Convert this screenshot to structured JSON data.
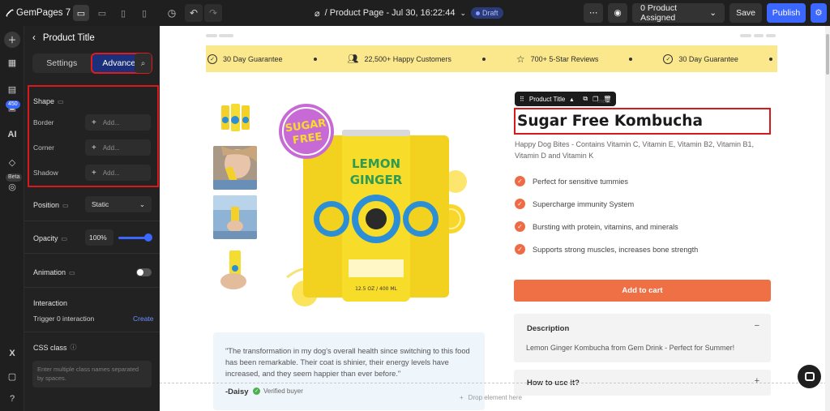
{
  "topbar": {
    "brand": "GemPages 7",
    "page_title": "/ Product Page - Jul 30, 16:22:44",
    "draft_badge": "Draft",
    "product_assigned": "0 Product Assigned",
    "save_label": "Save",
    "publish_label": "Publish"
  },
  "rail": {
    "badge_count": "450",
    "ai_label": "AI",
    "beta_label": "Beta"
  },
  "panel": {
    "title": "Product Title",
    "tabs": {
      "settings": "Settings",
      "advanced": "Advanced"
    },
    "shape_label": "Shape",
    "border_label": "Border",
    "corner_label": "Corner",
    "shadow_label": "Shadow",
    "add_placeholder": "Add...",
    "position_label": "Position",
    "position_value": "Static",
    "opacity_label": "Opacity",
    "opacity_value": "100%",
    "opacity_level": 1.0,
    "animation_label": "Animation",
    "interaction_label": "Interaction",
    "trigger_text": "Trigger 0 interaction",
    "create_label": "Create",
    "css_class_label": "CSS class",
    "css_placeholder": "Enter multiple class names separated by spaces."
  },
  "ticker": {
    "items": [
      "30 Day Guarantee",
      "22,500+ Happy Customers",
      "700+ 5-Star Reviews",
      "30 Day Guarantee"
    ]
  },
  "product": {
    "toolbar_label": "Product Title",
    "crumb_faint": "mers",
    "title": "Sugar Free Kombucha",
    "subtitle": "Happy Dog Bites - Contains Vitamin C, Vitamin E, Vitamin B2, Vitamin B1, Vitamin D and Vitamin K",
    "features": [
      "Perfect for sensitive tummies",
      "Supercharge immunity System",
      "Bursting with protein, vitamins, and minerals",
      "Supports strong muscles, increases bone strength"
    ],
    "cart_label": "Add to cart",
    "description_title": "Description",
    "description_body": "Lemon Ginger Kombucha from Gem Drink - Perfect for Summer!",
    "howto_title": "How to use it?",
    "hero_badge_top": "SUGAR",
    "hero_badge_bottom": "FREE",
    "can_text_top": "LEMON",
    "can_text_bottom": "GINGER",
    "can_volume": "12.5 OZ / 400 ML"
  },
  "review": {
    "text": "\"The transformation in my dog's overall health since switching to this food has been remarkable. Their coat is shinier, their energy levels have increased, and they seem happier than ever before.\"",
    "author": "-Daisy",
    "verified": "Verified buyer"
  },
  "canvas": {
    "drop_label": "Drop element here"
  },
  "colors": {
    "accent": "#3c67ff",
    "cta": "#f07046",
    "highlight": "#d8191b",
    "ticker_bg": "#fbe88c"
  }
}
